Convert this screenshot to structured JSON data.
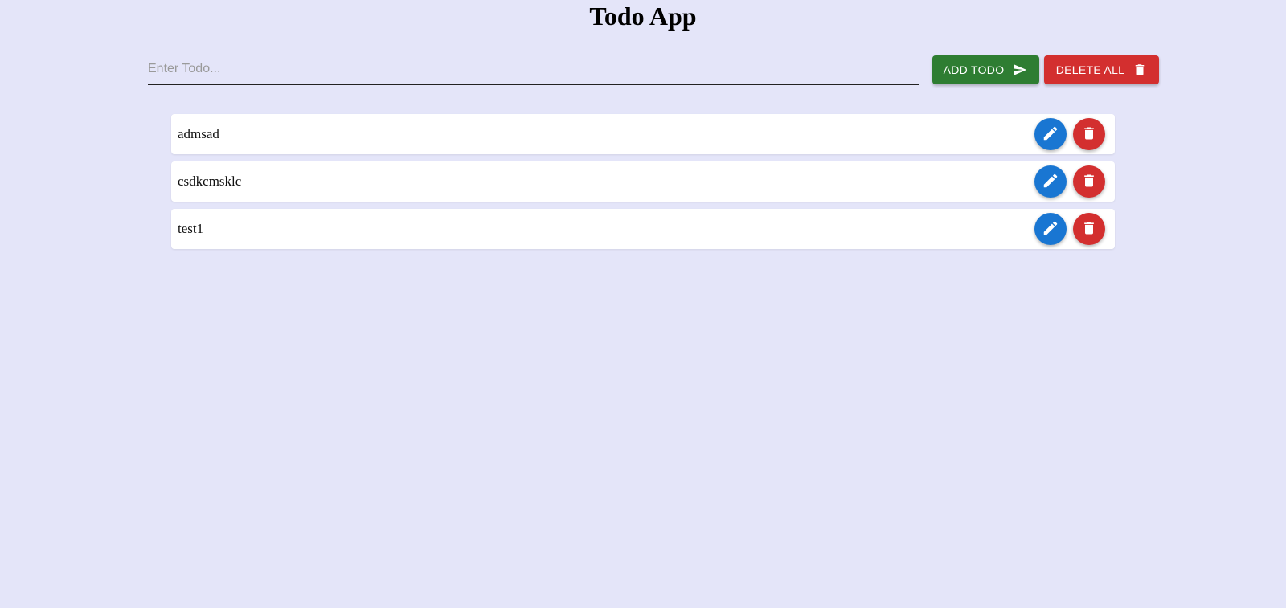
{
  "app": {
    "title": "Todo App"
  },
  "input": {
    "placeholder": "Enter Todo...",
    "value": ""
  },
  "toolbar": {
    "add_label": "ADD TODO",
    "add_icon": "send-icon",
    "delete_all_label": "DELETE ALL",
    "delete_all_icon": "trash-icon"
  },
  "todos": [
    {
      "text": "admsad"
    },
    {
      "text": "csdkcmsklc"
    },
    {
      "text": "test1"
    }
  ],
  "colors": {
    "background": "#e4e5f9",
    "add_button": "#2e7d32",
    "delete_button": "#d32f2f",
    "edit_button": "#1976d2"
  }
}
